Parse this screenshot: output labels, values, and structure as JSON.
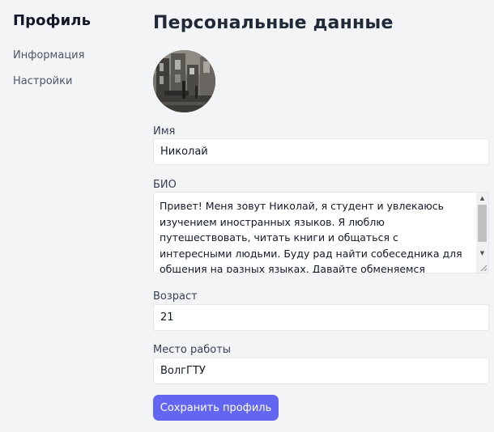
{
  "sidebar": {
    "title": "Профиль",
    "items": [
      {
        "label": "Информация"
      },
      {
        "label": "Настройки"
      }
    ]
  },
  "main": {
    "title": "Персональные данные",
    "avatar_icon": "user-photo",
    "fields": {
      "name": {
        "label": "Имя",
        "value": "Николай"
      },
      "bio": {
        "label": "БИО",
        "value": "Привет! Меня зовут Николай, я студент и увлекаюсь изучением иностранных языков. Я люблю путешествовать, читать книги и общаться с интересными людьми. Буду рад найти собеседника для общения на разных языках. Давайте обменяемся знаниями и вместе погрузимся в мир языков"
      },
      "age": {
        "label": "Возраст",
        "value": "21"
      },
      "workplace": {
        "label": "Место работы",
        "value": "ВолгГТУ"
      }
    },
    "save_label": "Сохранить профиль"
  },
  "colors": {
    "background": "#f3f4f6",
    "accent": "#6366f1",
    "input_background": "#ffffff"
  }
}
